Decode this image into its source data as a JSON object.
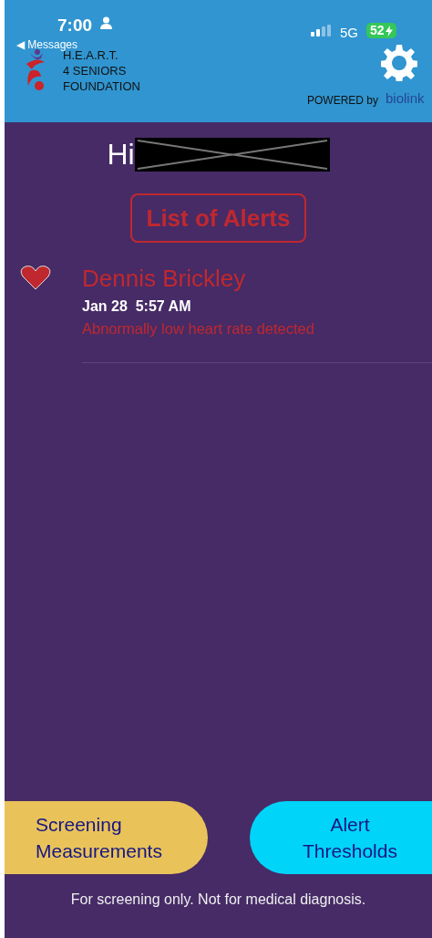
{
  "status_bar": {
    "time": "7:00",
    "back_label": "◀ Messages",
    "network": "5G",
    "battery": "52",
    "charging": true
  },
  "header": {
    "logo_lines": [
      "H.E.A.R.T.",
      "4 SENIORS",
      "FOUNDATION"
    ],
    "powered_by": "POWERED by",
    "partner": "biolink"
  },
  "greeting": {
    "text": "Hi",
    "name_redacted": true
  },
  "title_button": "List of Alerts",
  "alerts": [
    {
      "name": "Dennis Brickley",
      "date": "Jan 28",
      "time": "5:57 AM",
      "message": "Abnormally low heart rate detected"
    }
  ],
  "bottom_buttons": [
    {
      "label": "Screening Measurements",
      "kind": "left"
    },
    {
      "label": "Alert Thresholds",
      "kind": "right"
    }
  ],
  "disclaimer": "For screening only. Not for medical diagnosis."
}
